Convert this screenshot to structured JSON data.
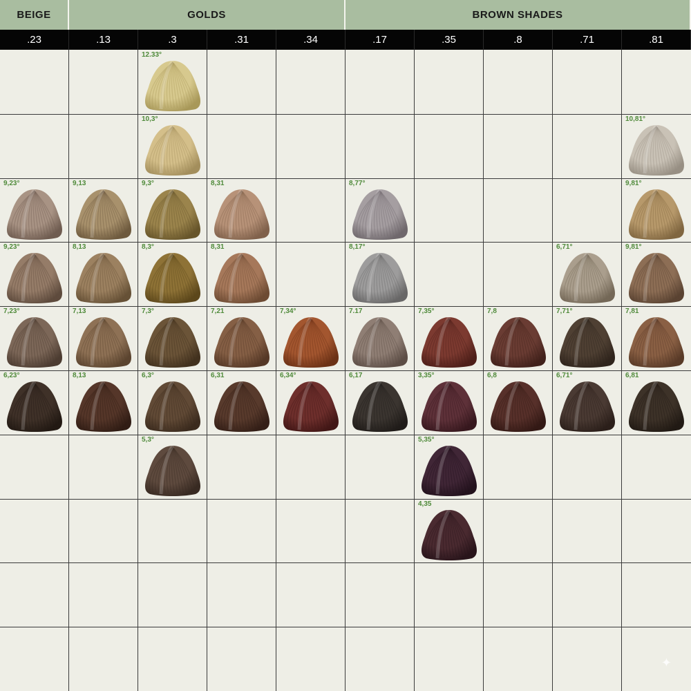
{
  "groups": [
    {
      "label": "BEIGE",
      "span": 1
    },
    {
      "label": "GOLDS",
      "span": 4
    },
    {
      "label": "BROWN SHADES",
      "span": 5
    }
  ],
  "columns": [
    ".23",
    ".13",
    ".3",
    ".31",
    ".34",
    ".17",
    ".35",
    ".8",
    ".71",
    ".81"
  ],
  "rows": 10,
  "swatches": [
    {
      "col": 2,
      "row": 0,
      "label": "12.33°",
      "color": "#d7c98e",
      "dark": "#a89859"
    },
    {
      "col": 2,
      "row": 1,
      "label": "10,3°",
      "color": "#d4bf8a",
      "dark": "#a38e5c"
    },
    {
      "col": 9,
      "row": 1,
      "label": "10,81°",
      "color": "#c9c2b6",
      "dark": "#978f83"
    },
    {
      "col": 0,
      "row": 2,
      "label": "9,23°",
      "color": "#a89384",
      "dark": "#6f5c50"
    },
    {
      "col": 1,
      "row": 2,
      "label": "9,13",
      "color": "#a8916c",
      "dark": "#6e5a3e"
    },
    {
      "col": 2,
      "row": 2,
      "label": "9,3°",
      "color": "#9b844c",
      "dark": "#67552a"
    },
    {
      "col": 3,
      "row": 2,
      "label": "8,31",
      "color": "#b79278",
      "dark": "#80614b"
    },
    {
      "col": 5,
      "row": 2,
      "label": "8,77°",
      "color": "#a59ea1",
      "dark": "#6f686c"
    },
    {
      "col": 9,
      "row": 2,
      "label": "9,81°",
      "color": "#b7996b",
      "dark": "#806640"
    },
    {
      "col": 0,
      "row": 3,
      "label": "9,23°",
      "color": "#957c68",
      "dark": "#5e4b3d"
    },
    {
      "col": 1,
      "row": 3,
      "label": "8,13",
      "color": "#9c8160",
      "dark": "#665136"
    },
    {
      "col": 2,
      "row": 3,
      "label": "8,3°",
      "color": "#8e7236",
      "dark": "#5c471b"
    },
    {
      "col": 3,
      "row": 3,
      "label": "8,31",
      "color": "#a6785a",
      "dark": "#6d4b33"
    },
    {
      "col": 5,
      "row": 3,
      "label": "8,17°",
      "color": "#9d9c9c",
      "dark": "#686767"
    },
    {
      "col": 8,
      "row": 3,
      "label": "6,71°",
      "color": "#aa9e8d",
      "dark": "#746857"
    },
    {
      "col": 9,
      "row": 3,
      "label": "9,81°",
      "color": "#8d6e55",
      "dark": "#5a4332"
    },
    {
      "col": 0,
      "row": 4,
      "label": "7,23°",
      "color": "#7c6758",
      "dark": "#4c3c31"
    },
    {
      "col": 1,
      "row": 4,
      "label": "7,13",
      "color": "#8e7155",
      "dark": "#5b442f"
    },
    {
      "col": 2,
      "row": 4,
      "label": "7,3°",
      "color": "#6b5438",
      "dark": "#42311e"
    },
    {
      "col": 3,
      "row": 4,
      "label": "7,21",
      "color": "#855f45",
      "dark": "#553826"
    },
    {
      "col": 4,
      "row": 4,
      "label": "7,34°",
      "color": "#a3562f",
      "dark": "#6c3216"
    },
    {
      "col": 5,
      "row": 4,
      "label": "7.17",
      "color": "#8f7e74",
      "dark": "#5d4e46"
    },
    {
      "col": 6,
      "row": 4,
      "label": "7,35°",
      "color": "#7c3a30",
      "dark": "#4e1f19"
    },
    {
      "col": 7,
      "row": 4,
      "label": "7,8",
      "color": "#6a3c33",
      "dark": "#41211b"
    },
    {
      "col": 8,
      "row": 4,
      "label": "7,71°",
      "color": "#4f4033",
      "dark": "#2f241c"
    },
    {
      "col": 9,
      "row": 4,
      "label": "7,81",
      "color": "#8a6044",
      "dark": "#583a27"
    },
    {
      "col": 0,
      "row": 5,
      "label": "6,23°",
      "color": "#3f3128",
      "dark": "#221913"
    },
    {
      "col": 1,
      "row": 5,
      "label": "8,13",
      "color": "#553629",
      "dark": "#311d15"
    },
    {
      "col": 2,
      "row": 5,
      "label": "6,3°",
      "color": "#614a36",
      "dark": "#3b2b1e"
    },
    {
      "col": 3,
      "row": 5,
      "label": "6,31",
      "color": "#583a2c",
      "dark": "#341f17"
    },
    {
      "col": 4,
      "row": 5,
      "label": "6,34°",
      "color": "#6e2f2c",
      "dark": "#421716"
    },
    {
      "col": 5,
      "row": 5,
      "label": "6,17",
      "color": "#3b3530",
      "dark": "#201c19"
    },
    {
      "col": 6,
      "row": 5,
      "label": "3,35°",
      "color": "#5e3139",
      "dark": "#37181e"
    },
    {
      "col": 7,
      "row": 5,
      "label": "6,8",
      "color": "#57302a",
      "dark": "#331915"
    },
    {
      "col": 8,
      "row": 5,
      "label": "6,71°",
      "color": "#4a3a33",
      "dark": "#2b1f1a"
    },
    {
      "col": 9,
      "row": 5,
      "label": "6,81",
      "color": "#3d3228",
      "dark": "#211a14"
    },
    {
      "col": 2,
      "row": 6,
      "label": "5,3°",
      "color": "#5e4a3e",
      "dark": "#382a22"
    },
    {
      "col": 6,
      "row": 6,
      "label": "5,35°",
      "color": "#402636",
      "dark": "#23121d"
    },
    {
      "col": 6,
      "row": 7,
      "label": "4,35",
      "color": "#4a2a30",
      "dark": "#28141a"
    }
  ],
  "accent_label_color": "#4f8a3a",
  "header_green": "#a9bda0",
  "background": "#eeeee6"
}
